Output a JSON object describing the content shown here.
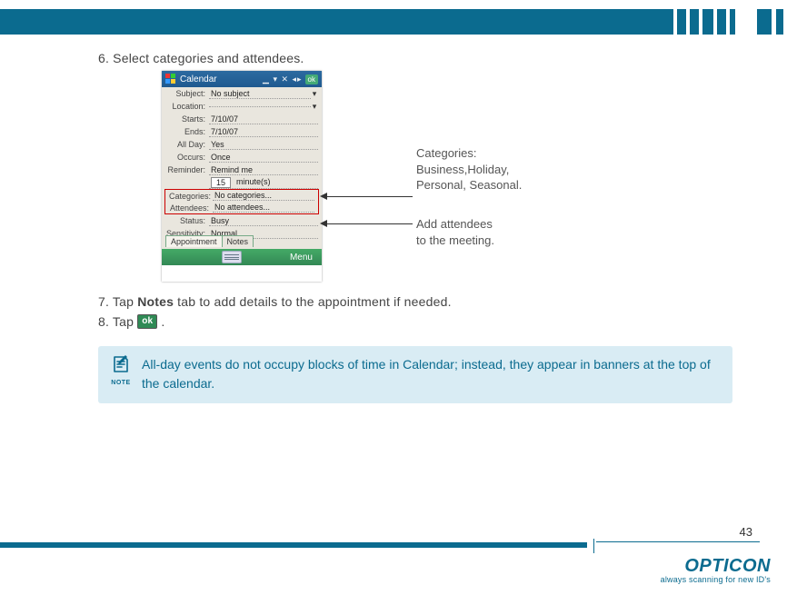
{
  "header": {
    "stripe_widths": [
      4,
      10,
      4,
      10,
      4,
      12,
      4,
      10,
      4,
      6,
      4,
      24,
      4,
      14,
      6,
      10
    ]
  },
  "steps": {
    "s6": "6. Select categories and attendees.",
    "s7_pre": "7. Tap ",
    "s7_bold": "Notes",
    "s7_post": " tab to add details to the appointment if needed.",
    "s8_pre": "8. Tap ",
    "s8_chip": "ok",
    "s8_post": " ."
  },
  "device": {
    "title": "Calendar",
    "ok": "ok",
    "rows": {
      "subject_lbl": "Subject:",
      "subject_val": "No subject",
      "location_lbl": "Location:",
      "location_val": "",
      "starts_lbl": "Starts:",
      "starts_val": "7/10/07",
      "ends_lbl": "Ends:",
      "ends_val": "7/10/07",
      "allday_lbl": "All Day:",
      "allday_val": "Yes",
      "occurs_lbl": "Occurs:",
      "occurs_val": "Once",
      "reminder_lbl": "Reminder:",
      "reminder_val": "Remind me",
      "reminder_num": "15",
      "reminder_unit": "minute(s)",
      "categories_lbl": "Categories:",
      "categories_val": "No categories...",
      "attendees_lbl": "Attendees:",
      "attendees_val": "No attendees...",
      "status_lbl": "Status:",
      "status_val": "Busy",
      "sensitivity_lbl": "Sensitivity:",
      "sensitivity_val": "Normal"
    },
    "tabs": {
      "appointment": "Appointment",
      "notes": "Notes"
    },
    "menu": "Menu"
  },
  "callouts": {
    "categories_l1": "Categories:",
    "categories_l2": "Business,Holiday,",
    "categories_l3": "Personal, Seasonal.",
    "attendees_l1": "Add attendees",
    "attendees_l2": "to the meeting."
  },
  "note": {
    "label": "NOTE",
    "text": "All-day events do not occupy blocks of time in Calendar; instead, they appear in banners at the top of the calendar."
  },
  "footer": {
    "page": "43",
    "brand": "OPTICON",
    "tag": "always scanning for new ID's"
  }
}
